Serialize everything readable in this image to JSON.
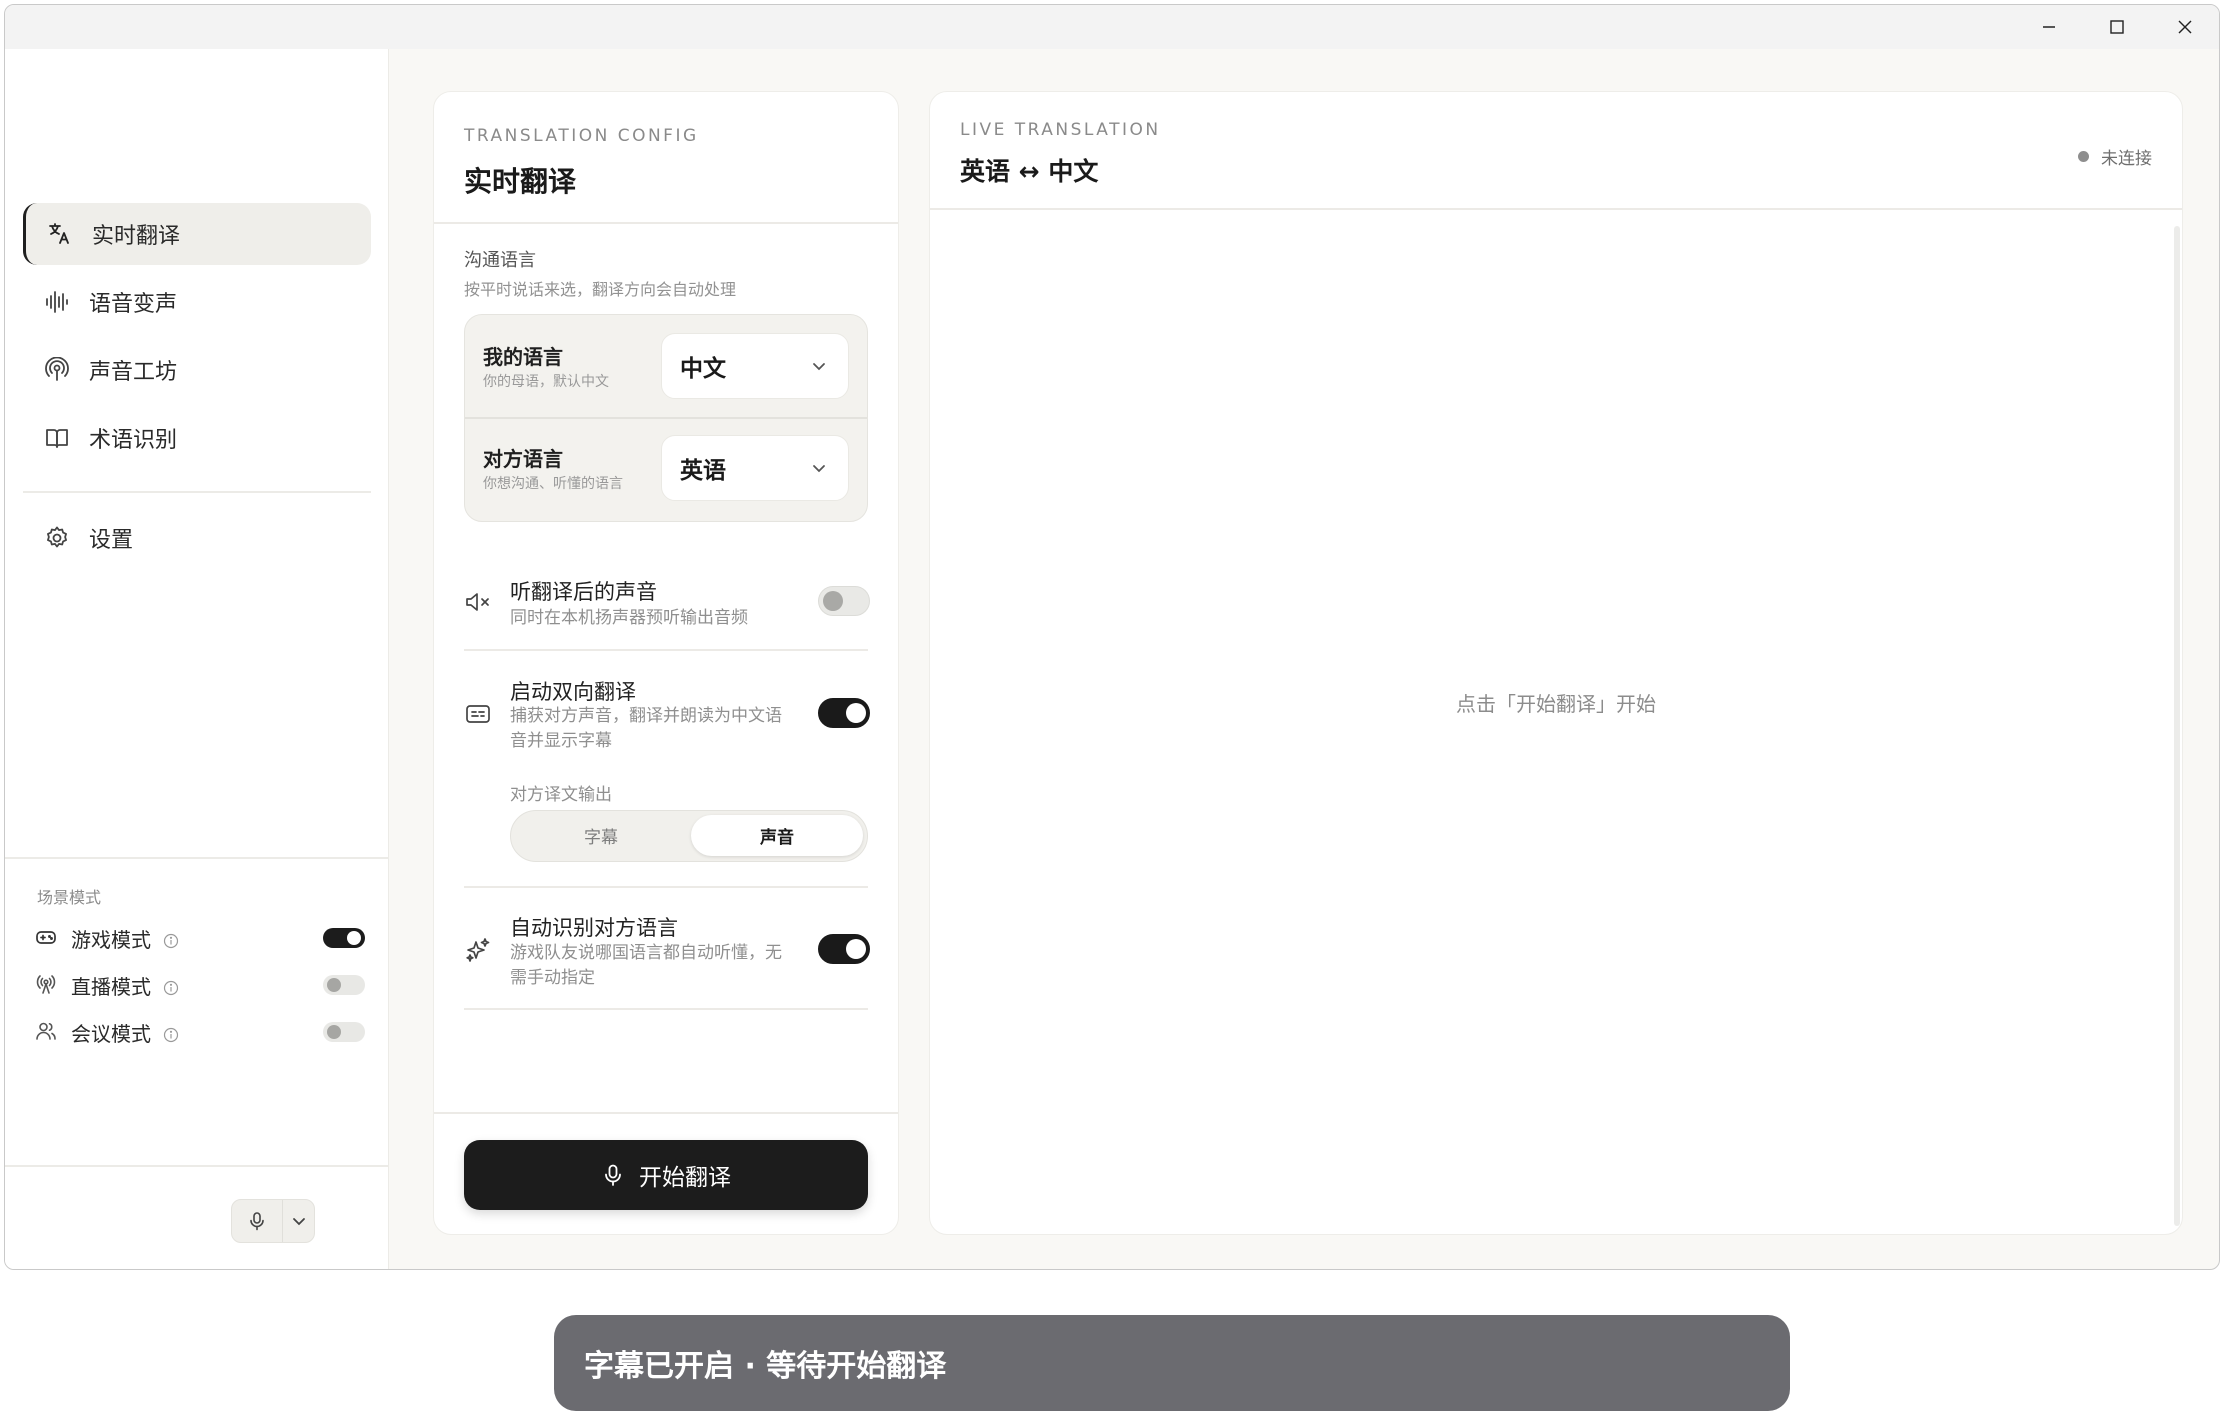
{
  "window": {
    "controls": {
      "minimize": "minimize-icon",
      "maximize": "maximize-icon",
      "close": "close-icon"
    }
  },
  "sidebar": {
    "items": [
      {
        "label": "实时翻译",
        "icon": "translate-icon",
        "active": true
      },
      {
        "label": "语音变声",
        "icon": "waveform-icon",
        "active": false
      },
      {
        "label": "声音工坊",
        "icon": "podcast-icon",
        "active": false
      },
      {
        "label": "术语识别",
        "icon": "book-icon",
        "active": false
      }
    ],
    "settings": {
      "label": "设置",
      "icon": "gear-icon"
    },
    "scene": {
      "title": "场景模式",
      "modes": [
        {
          "label": "游戏模式",
          "icon": "gamepad-icon",
          "enabled": true
        },
        {
          "label": "直播模式",
          "icon": "broadcast-icon",
          "enabled": false
        },
        {
          "label": "会议模式",
          "icon": "users-icon",
          "enabled": false
        }
      ]
    },
    "mic": {
      "icon": "microphone-icon",
      "dropdown_icon": "chevron-down-icon"
    }
  },
  "config": {
    "eyebrow": "TRANSLATION CONFIG",
    "title": "实时翻译",
    "section_title": "沟通语言",
    "section_sub": "按平时说话来选，翻译方向会自动处理",
    "my_lang": {
      "label": "我的语言",
      "sub": "你的母语，默认中文",
      "value": "中文"
    },
    "their_lang": {
      "label": "对方语言",
      "sub": "你想沟通、听懂的语言",
      "value": "英语"
    },
    "options": {
      "listen": {
        "title": "听翻译后的声音",
        "sub": "同时在本机扬声器预听输出音频",
        "enabled": false,
        "icon": "speaker-mute-icon"
      },
      "bidirectional": {
        "title": "启动双向翻译",
        "sub1": "捕获对方声音，翻译并朗读为中文语",
        "sub2": "音并显示字幕",
        "enabled": true,
        "icon": "subtitles-icon"
      },
      "auto_detect": {
        "title": "自动识别对方语言",
        "sub1": "游戏队友说哪国语言都自动听懂，无",
        "sub2": "需手动指定",
        "enabled": true,
        "icon": "sparkles-icon"
      }
    },
    "output": {
      "label": "对方译文输出",
      "choices": [
        "字幕",
        "声音"
      ],
      "selected": "声音"
    },
    "start_button": "开始翻译"
  },
  "live": {
    "eyebrow": "LIVE TRANSLATION",
    "title": "英语 ↔ 中文",
    "status": "未连接",
    "placeholder": "点击「开始翻译」开始"
  },
  "toast": "字幕已开启 · 等待开始翻译"
}
